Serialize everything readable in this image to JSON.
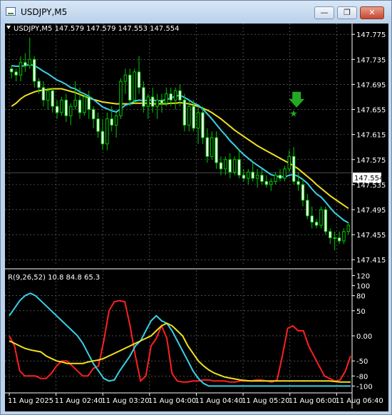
{
  "window": {
    "title": "USDJPY,M5",
    "minimize_glyph": "—",
    "maximize_glyph": "❐",
    "close_glyph": "✕",
    "icon": "chart-window-icon"
  },
  "chart_data": [
    {
      "type": "candlestick",
      "header": "USDJPY,M5  147.579 147.579 147.553 147.554",
      "price_label": "147.554",
      "y_ticks": [
        "147.775",
        "147.735",
        "147.695",
        "147.655",
        "147.615",
        "147.575",
        "147.535",
        "147.495",
        "147.455",
        "147.415"
      ],
      "ylim": [
        147.405,
        147.79
      ],
      "colors": {
        "bull": "#00c800",
        "bear": "#00c800",
        "ma_fast": "#3ad0e8",
        "ma_slow": "#f0e020",
        "signal": "#22aa22",
        "grid": "#7a7a7a"
      },
      "candles": [
        [
          147.72,
          147.725,
          147.705,
          147.715
        ],
        [
          147.715,
          147.72,
          147.7,
          147.71
        ],
        [
          147.71,
          147.74,
          147.7,
          147.73
        ],
        [
          147.73,
          147.745,
          147.715,
          147.725
        ],
        [
          147.725,
          147.77,
          147.72,
          147.735
        ],
        [
          147.735,
          147.74,
          147.69,
          147.7
        ],
        [
          147.7,
          147.705,
          147.68,
          147.69
        ],
        [
          147.69,
          147.7,
          147.66,
          147.67
        ],
        [
          147.67,
          147.69,
          147.655,
          147.685
        ],
        [
          147.685,
          147.69,
          147.65,
          147.66
        ],
        [
          147.66,
          147.67,
          147.64,
          147.65
        ],
        [
          147.65,
          147.675,
          147.645,
          147.67
        ],
        [
          147.67,
          147.68,
          147.635,
          147.645
        ],
        [
          147.645,
          147.665,
          147.63,
          147.66
        ],
        [
          147.66,
          147.7,
          147.655,
          147.67
        ],
        [
          147.67,
          147.69,
          147.64,
          147.65
        ],
        [
          147.65,
          147.68,
          147.645,
          147.675
        ],
        [
          147.675,
          147.685,
          147.64,
          147.655
        ],
        [
          147.655,
          147.66,
          147.625,
          147.64
        ],
        [
          147.64,
          147.65,
          147.61,
          147.62
        ],
        [
          147.62,
          147.64,
          147.59,
          147.6
        ],
        [
          147.6,
          147.65,
          147.59,
          147.64
        ],
        [
          147.64,
          147.66,
          147.62,
          147.63
        ],
        [
          147.63,
          147.65,
          147.61,
          147.645
        ],
        [
          147.645,
          147.705,
          147.64,
          147.7
        ],
        [
          147.7,
          147.72,
          147.68,
          147.71
        ],
        [
          147.71,
          147.72,
          147.66,
          147.67
        ],
        [
          147.67,
          147.72,
          147.665,
          147.715
        ],
        [
          147.715,
          147.74,
          147.68,
          147.69
        ],
        [
          147.69,
          147.7,
          147.65,
          147.66
        ],
        [
          147.66,
          147.68,
          147.64,
          147.675
        ],
        [
          147.675,
          147.69,
          147.65,
          147.66
        ],
        [
          147.66,
          147.68,
          147.64,
          147.67
        ],
        [
          147.67,
          147.68,
          147.65,
          147.665
        ],
        [
          147.665,
          147.69,
          147.66,
          147.68
        ],
        [
          147.68,
          147.69,
          147.66,
          147.67
        ],
        [
          147.67,
          147.69,
          147.655,
          147.685
        ],
        [
          147.685,
          147.695,
          147.66,
          147.67
        ],
        [
          147.67,
          147.68,
          147.62,
          147.63
        ],
        [
          147.63,
          147.67,
          147.62,
          147.66
        ],
        [
          147.66,
          147.67,
          147.62,
          147.625
        ],
        [
          147.625,
          147.66,
          147.6,
          147.65
        ],
        [
          147.65,
          147.66,
          147.6,
          147.61
        ],
        [
          147.61,
          147.625,
          147.57,
          147.58
        ],
        [
          147.58,
          147.62,
          147.575,
          147.61
        ],
        [
          147.61,
          147.62,
          147.56,
          147.57
        ],
        [
          147.57,
          147.58,
          147.55,
          147.56
        ],
        [
          147.56,
          147.58,
          147.55,
          147.575
        ],
        [
          147.575,
          147.585,
          147.545,
          147.555
        ],
        [
          147.555,
          147.58,
          147.55,
          147.575
        ],
        [
          147.575,
          147.59,
          147.545,
          147.55
        ],
        [
          147.55,
          147.56,
          147.54,
          147.545
        ],
        [
          147.545,
          147.56,
          147.535,
          147.555
        ],
        [
          147.555,
          147.57,
          147.54,
          147.545
        ],
        [
          147.545,
          147.56,
          147.53,
          147.55
        ],
        [
          147.55,
          147.56,
          147.535,
          147.54
        ],
        [
          147.54,
          147.55,
          147.53,
          147.535
        ],
        [
          147.535,
          147.545,
          147.525,
          147.54
        ],
        [
          147.54,
          147.555,
          147.535,
          147.55
        ],
        [
          147.55,
          147.56,
          147.54,
          147.545
        ],
        [
          147.545,
          147.565,
          147.54,
          147.56
        ],
        [
          147.56,
          147.59,
          147.555,
          147.58
        ],
        [
          147.58,
          147.595,
          147.535,
          147.54
        ],
        [
          147.54,
          147.555,
          147.525,
          147.535
        ],
        [
          147.535,
          147.545,
          147.5,
          147.51
        ],
        [
          147.51,
          147.52,
          147.48,
          147.485
        ],
        [
          147.485,
          147.5,
          147.465,
          147.475
        ],
        [
          147.475,
          147.48,
          147.465,
          147.47
        ],
        [
          147.47,
          147.5,
          147.465,
          147.495
        ],
        [
          147.495,
          147.5,
          147.455,
          147.46
        ],
        [
          147.46,
          147.465,
          147.44,
          147.45
        ],
        [
          147.45,
          147.46,
          147.43,
          147.45
        ],
        [
          147.45,
          147.46,
          147.44,
          147.445
        ],
        [
          147.445,
          147.465,
          147.44,
          147.46
        ],
        [
          147.46,
          147.475,
          147.455,
          147.47
        ]
      ],
      "ma_fast": [
        147.725,
        147.724,
        147.724,
        147.725,
        147.727,
        147.725,
        147.721,
        147.716,
        147.712,
        147.707,
        147.702,
        147.699,
        147.695,
        147.69,
        147.688,
        147.683,
        147.68,
        147.676,
        147.671,
        147.665,
        147.659,
        147.656,
        147.653,
        147.651,
        147.656,
        147.662,
        147.664,
        147.668,
        147.67,
        147.669,
        147.67,
        147.67,
        147.669,
        147.669,
        147.671,
        147.673,
        147.676,
        147.678,
        147.674,
        147.67,
        147.665,
        147.662,
        147.656,
        147.648,
        147.64,
        147.631,
        147.622,
        147.614,
        147.605,
        147.598,
        147.59,
        147.583,
        147.577,
        147.571,
        147.566,
        147.561,
        147.556,
        147.551,
        147.549,
        147.547,
        147.547,
        147.55,
        147.551,
        147.548,
        147.543,
        147.537,
        147.528,
        147.52,
        147.515,
        147.507,
        147.498,
        147.49,
        147.484,
        147.478,
        147.474
      ],
      "ma_slow": [
        147.66,
        147.665,
        147.672,
        147.677,
        147.68,
        147.683,
        147.685,
        147.686,
        147.687,
        147.688,
        147.688,
        147.688,
        147.686,
        147.684,
        147.682,
        147.679,
        147.676,
        147.673,
        147.671,
        147.669,
        147.667,
        147.666,
        147.665,
        147.664,
        147.664,
        147.664,
        147.664,
        147.665,
        147.665,
        147.665,
        147.665,
        147.664,
        147.664,
        147.664,
        147.664,
        147.665,
        147.665,
        147.666,
        147.665,
        147.664,
        147.662,
        147.66,
        147.657,
        147.654,
        147.65,
        147.645,
        147.64,
        147.634,
        147.628,
        147.622,
        147.617,
        147.612,
        147.607,
        147.602,
        147.597,
        147.593,
        147.589,
        147.585,
        147.581,
        147.577,
        147.573,
        147.569,
        147.565,
        147.56,
        147.554,
        147.548,
        147.542,
        147.535,
        147.529,
        147.523,
        147.517,
        147.512,
        147.507,
        147.502,
        147.497
      ],
      "signal_index": 62,
      "signal_price": 147.64
    },
    {
      "type": "line",
      "header": "R(9,26,52) 10.8 84.8 65.3",
      "y_ticks": [
        "120",
        "100",
        "80",
        "50",
        "0.00",
        "-50",
        "-80",
        "-100"
      ],
      "ylim": [
        -108,
        125
      ],
      "x_labels": [
        "11 Aug 2025",
        "11 Aug 02:40",
        "11 Aug 03:20",
        "11 Aug 04:00",
        "11 Aug 04:40",
        "11 Aug 05:20",
        "11 Aug 06:00",
        "11 Aug 06:40"
      ],
      "series": [
        {
          "color": "#ff2020",
          "values": [
            0,
            -20,
            -70,
            -80,
            -80,
            -80,
            -85,
            -85,
            -75,
            -60,
            -50,
            -50,
            -60,
            -70,
            -80,
            -80,
            -65,
            -60,
            -10,
            50,
            68,
            70,
            68,
            20,
            -40,
            -90,
            -80,
            -20,
            -5,
            20,
            -5,
            -75,
            -90,
            -92,
            -92,
            -90,
            -90,
            -88,
            -88,
            -90,
            -90,
            -90,
            -92,
            -92,
            -90,
            -90,
            -90,
            -88,
            -88,
            -90,
            -92,
            -88,
            -40,
            15,
            20,
            10,
            10,
            -20,
            -40,
            -60,
            -80,
            -85,
            -90,
            -88,
            -70,
            -40
          ]
        },
        {
          "color": "#3ad0e8",
          "values": [
            40,
            55,
            70,
            80,
            85,
            80,
            70,
            60,
            50,
            40,
            30,
            20,
            10,
            0,
            -15,
            -35,
            -55,
            -70,
            -85,
            -90,
            -88,
            -70,
            -55,
            -40,
            -20,
            -10,
            10,
            30,
            40,
            30,
            25,
            10,
            -10,
            -30,
            -50,
            -70,
            -85,
            -95,
            -100,
            -100,
            -100,
            -100,
            -100,
            -100,
            -100,
            -100,
            -100,
            -100,
            -100,
            -100,
            -100,
            -100,
            -100,
            -100,
            -100,
            -100,
            -100,
            -100,
            -100,
            -100,
            -100,
            -100,
            -100,
            -100,
            -100,
            -100
          ]
        },
        {
          "color": "#f0e020",
          "values": [
            -10,
            -15,
            -20,
            -25,
            -28,
            -30,
            -32,
            -40,
            -45,
            -50,
            -52,
            -55,
            -55,
            -55,
            -55,
            -52,
            -50,
            -48,
            -45,
            -40,
            -35,
            -30,
            -25,
            -20,
            -15,
            -10,
            -5,
            0,
            10,
            20,
            25,
            20,
            10,
            0,
            -20,
            -35,
            -50,
            -60,
            -68,
            -74,
            -78,
            -82,
            -84,
            -86,
            -88,
            -89,
            -90,
            -90,
            -90,
            -90,
            -90,
            -90,
            -90,
            -90,
            -90,
            -90,
            -90,
            -90,
            -90,
            -90,
            -90,
            -90,
            -91,
            -92,
            -92,
            -92
          ]
        }
      ]
    }
  ]
}
